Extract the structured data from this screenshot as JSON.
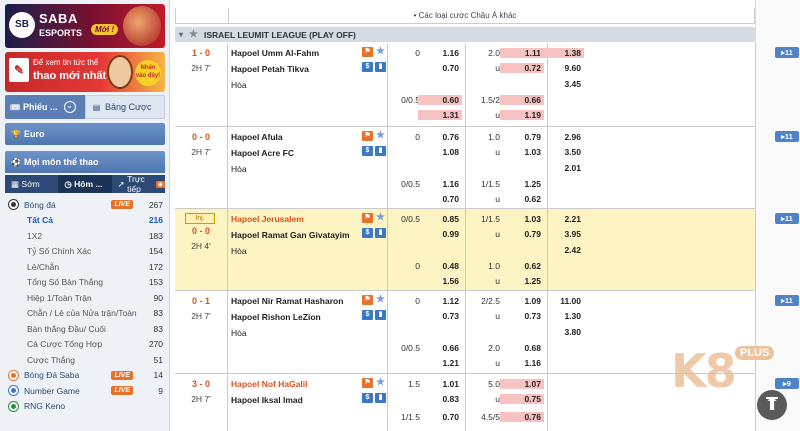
{
  "sidebar": {
    "banner1": {
      "brand": "SABA",
      "sub": "ESPORTS",
      "badge": "Mới !",
      "logo_letters": "SB"
    },
    "banner2": {
      "line1": "Để xem tin tức thể",
      "line2": "thao mới nhất",
      "badge": "Nhấn vào đây!"
    },
    "tabs": {
      "phieu": "Phiếu ...",
      "bang_cuoc": "Bảng Cược"
    },
    "euro": "Euro",
    "all_sports": "Mọi môn thể thao",
    "sub_tabs": {
      "som": "Sớm",
      "hom": "Hôm ...",
      "truc_tiep": "Trực tiếp"
    },
    "sports": [
      {
        "label": "Bóng đá",
        "live": "LIVE",
        "count": "267",
        "kind": "main",
        "icon": "soccer-ball-icon"
      },
      {
        "label": "Tất Cả",
        "count": "216",
        "kind": "sub",
        "active": true
      },
      {
        "label": "1X2",
        "count": "183",
        "kind": "sub"
      },
      {
        "label": "Tỷ Số Chính Xác",
        "count": "154",
        "kind": "sub"
      },
      {
        "label": "Lẻ/Chẵn",
        "count": "172",
        "kind": "sub"
      },
      {
        "label": "Tổng Số Bàn Thắng",
        "count": "153",
        "kind": "sub"
      },
      {
        "label": "Hiệp 1/Toàn Trận",
        "count": "90",
        "kind": "sub"
      },
      {
        "label": "Chẵn / Lẻ của Nửa trận/Toàn",
        "count": "83",
        "kind": "sub"
      },
      {
        "label": "Bàn thắng Đầu/ Cuối",
        "count": "83",
        "kind": "sub"
      },
      {
        "label": "Cá Cược Tổng Hợp",
        "count": "270",
        "kind": "sub"
      },
      {
        "label": "Cược Thắng",
        "count": "51",
        "kind": "sub"
      },
      {
        "label": "Bóng Đá Saba",
        "live": "LIVE",
        "count": "14",
        "kind": "main",
        "icon": "saba-ball-icon"
      },
      {
        "label": "Number Game",
        "live": "LIVE",
        "count": "9",
        "kind": "main",
        "icon": "number-game-icon"
      },
      {
        "label": "RNG Keno",
        "count": "",
        "kind": "main",
        "icon": "keno-icon"
      }
    ]
  },
  "main": {
    "top_note": "• Các loại cược Châu Á khác",
    "league": "ISRAEL LEUMIT LEAGUE (PLAY OFF)",
    "matches": [
      {
        "score": "1 - 0",
        "time": "2H 7'",
        "inj": "",
        "highlight": false,
        "home_red": false,
        "home": "Hapoel Umm Al-Fahm",
        "away": "Hapoel Petah Tikva",
        "draw": "Hòa",
        "more": "11",
        "lines": [
          {
            "h1": "0",
            "o1a": "1.16",
            "o1b": "0.70",
            "h2": "2.0",
            "u": "u",
            "o2a": "1.11",
            "o2b": "0.72",
            "x1": "1.38",
            "x2": "9.60",
            "x3": "3.45"
          },
          {
            "h1": "0/0.5",
            "o1a": "0.60",
            "o1b": "1.31",
            "h2": "1.5/2",
            "u": "u",
            "o2a": "0.66",
            "o2b": "1.19"
          }
        ]
      },
      {
        "score": "0 - 0",
        "time": "2H 7'",
        "inj": "",
        "highlight": false,
        "home_red": false,
        "home": "Hapoel Afula",
        "away": "Hapoel Acre FC",
        "draw": "Hòa",
        "more": "11",
        "lines": [
          {
            "h1": "0",
            "o1a": "0.76",
            "o1b": "1.08",
            "h2": "1.0",
            "u": "u",
            "o2a": "0.79",
            "o2b": "1.03",
            "x1": "2.96",
            "x2": "3.50",
            "x3": "2.01"
          },
          {
            "h1": "0/0.5",
            "o1a": "1.16",
            "o1b": "0.70",
            "h2": "1/1.5",
            "u": "u",
            "o2a": "1.25",
            "o2b": "0.62"
          }
        ]
      },
      {
        "score": "0 - 0",
        "time": "2H 4'",
        "inj": "Inj.",
        "highlight": true,
        "home_red": true,
        "home": "Hapoel Jerusalem",
        "away": "Hapoel Ramat Gan Givatayim",
        "draw": "Hòa",
        "more": "11",
        "lines": [
          {
            "h1": "0/0.5",
            "o1a": "0.85",
            "o1b": "0.99",
            "h2": "1/1.5",
            "u": "u",
            "o2a": "1.03",
            "o2b": "0.79",
            "x1": "2.21",
            "x2": "3.95",
            "x3": "2.42"
          },
          {
            "h1": "0",
            "o1a": "0.48",
            "o1b": "1.56",
            "h2": "1.0",
            "u": "u",
            "o2a": "0.62",
            "o2b": "1.25"
          }
        ]
      },
      {
        "score": "0 - 1",
        "time": "2H 7'",
        "inj": "",
        "highlight": false,
        "home_red": false,
        "home": "Hapoel Nir Ramat Hasharon",
        "away": "Hapoel Rishon LeZion",
        "draw": "Hòa",
        "more": "11",
        "lines": [
          {
            "h1": "0",
            "o1a": "1.12",
            "o1b": "0.73",
            "h2": "2/2.5",
            "u": "u",
            "o2a": "1.09",
            "o2b": "0.73",
            "x1": "11.00",
            "x2": "1.30",
            "x3": "3.80"
          },
          {
            "h1": "0/0.5",
            "o1a": "0.66",
            "o1b": "1.21",
            "h2": "2.0",
            "u": "u",
            "o2a": "0.68",
            "o2b": "1.16"
          }
        ]
      },
      {
        "score": "3 - 0",
        "time": "2H 7'",
        "inj": "",
        "highlight": false,
        "home_red": true,
        "home": "Hapoel Nof HaGalil",
        "away": "Hapoel Iksal Imad",
        "draw": "",
        "more": "9",
        "lines": [
          {
            "h1": "1.5",
            "o1a": "1.01",
            "o1b": "0.83",
            "h2": "5.0",
            "u": "u",
            "o2a": "1.07",
            "o2b": "0.75"
          },
          {
            "h1": "1/1.5",
            "o1a": "0.70",
            "o1b": "",
            "h2": "4.5/5",
            "u": "",
            "o2a": "0.76",
            "o2b": ""
          }
        ]
      }
    ]
  },
  "watermark": {
    "brand": "K8",
    "plus": "PLUS"
  },
  "colors": {
    "accent_blue": "#4f82c7",
    "score_orange": "#d9531e",
    "highlight_row": "#fdf3c3",
    "odds_pink": "#f6c2c2"
  }
}
